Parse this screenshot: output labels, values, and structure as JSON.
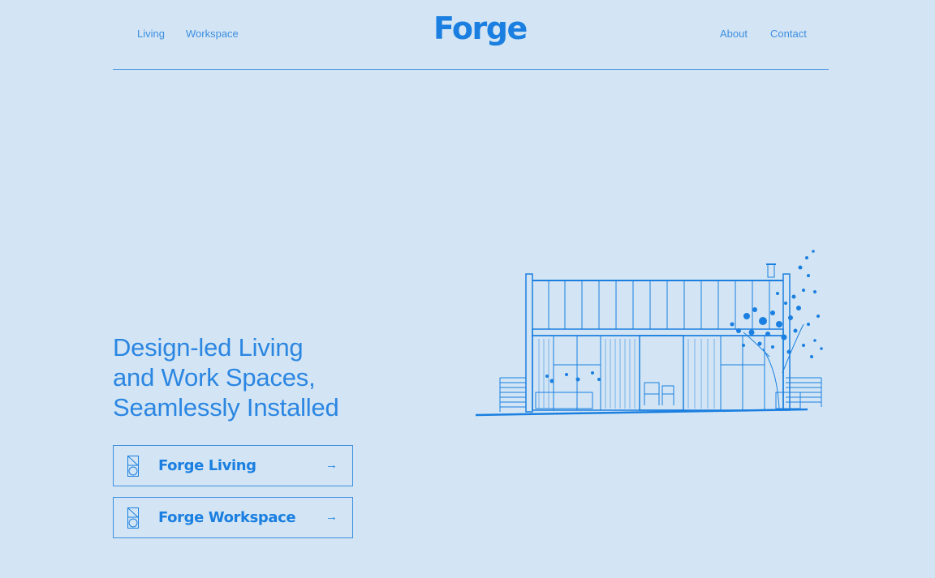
{
  "header": {
    "nav_left": [
      "Living",
      "Workspace"
    ],
    "logo": "Forge",
    "nav_right": [
      "About",
      "Contact"
    ]
  },
  "hero": {
    "lines": [
      "Design-led Living",
      "and Work Spaces,",
      "Seamlessly Installed"
    ]
  },
  "ctas": [
    {
      "label": "Forge Living",
      "arrow": "→",
      "icon": "forge-living-icon"
    },
    {
      "label": "Forge Workspace",
      "arrow": "→",
      "icon": "forge-workspace-icon"
    }
  ],
  "illustration": {
    "icon": "building-sketch-icon"
  },
  "colors": {
    "background": "#d3e5f4",
    "accent": "#1a7fe0",
    "line": "#3d8ee0"
  }
}
